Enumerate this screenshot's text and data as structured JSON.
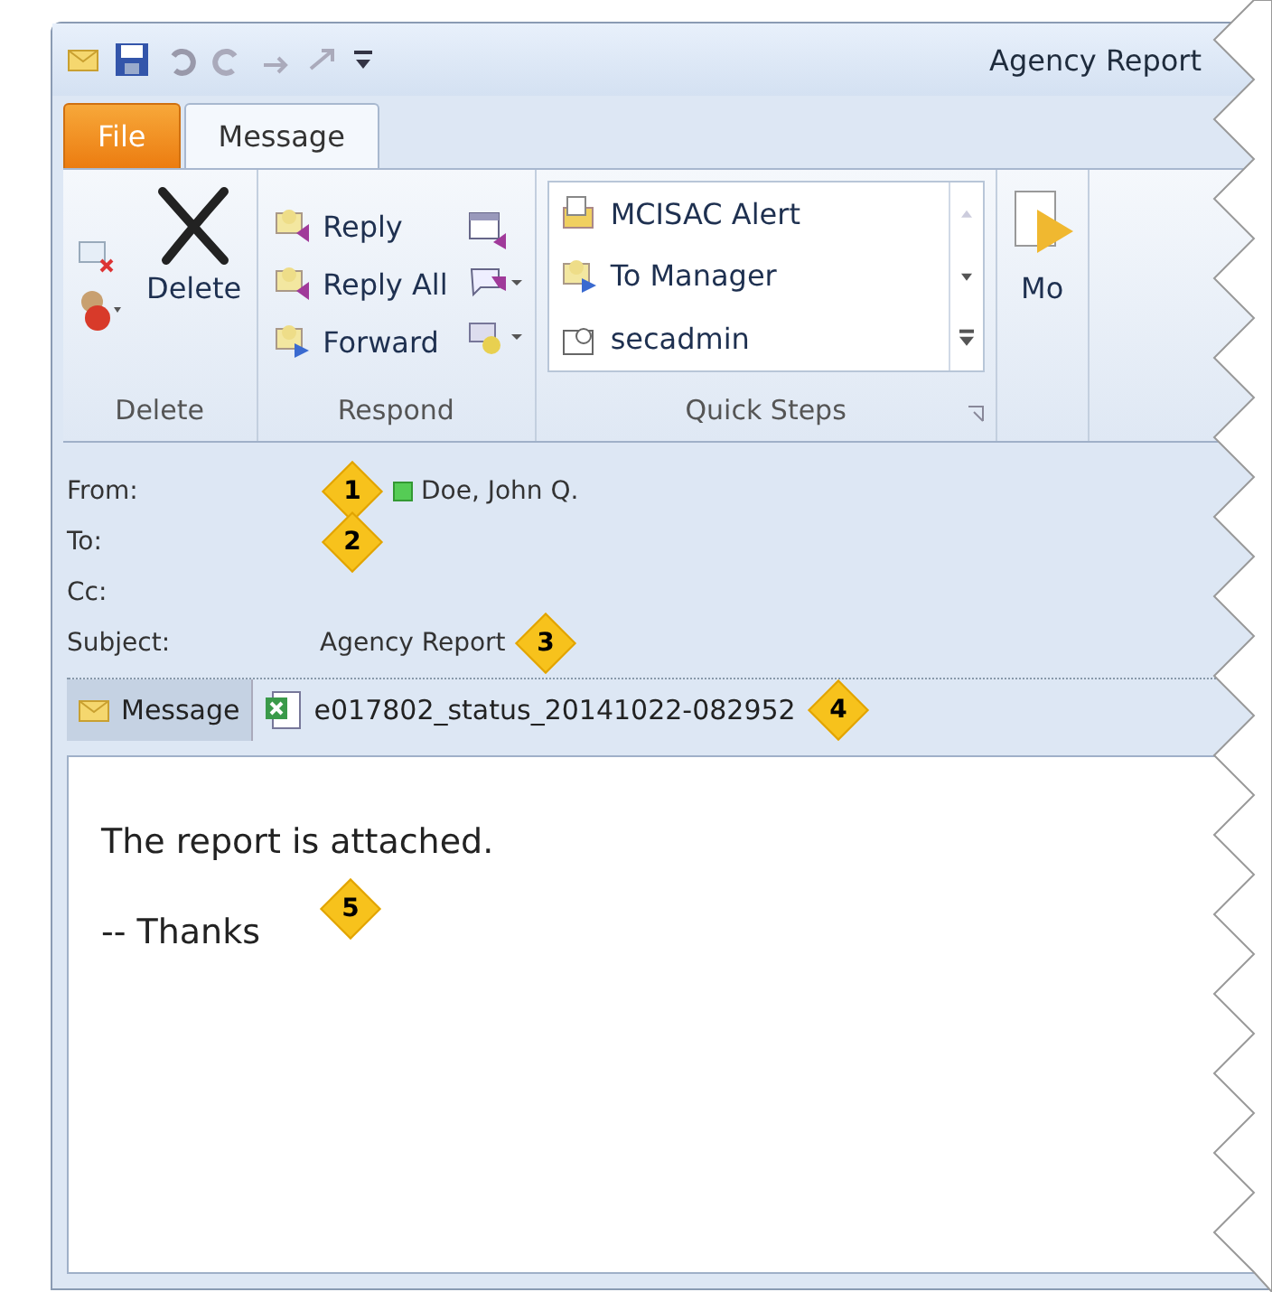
{
  "window": {
    "title": "Agency Report"
  },
  "tabs": [
    {
      "label": "File",
      "kind": "file",
      "selected": false
    },
    {
      "label": "Message",
      "kind": "tab",
      "selected": true
    }
  ],
  "ribbon": {
    "groups": [
      {
        "name": "Delete",
        "kind": "delete",
        "buttons": [
          {
            "label": "Delete"
          }
        ]
      },
      {
        "name": "Respond",
        "kind": "respond",
        "buttons": [
          {
            "label": "Reply"
          },
          {
            "label": "Reply All"
          },
          {
            "label": "Forward"
          }
        ]
      },
      {
        "name": "Quick Steps",
        "kind": "quicksteps",
        "buttons": [
          {
            "label": "MCISAC Alert"
          },
          {
            "label": "To Manager"
          },
          {
            "label": "secadmin"
          }
        ]
      },
      {
        "kind": "move",
        "buttons": [
          {
            "label": "Mo"
          }
        ]
      }
    ]
  },
  "header": {
    "fields": [
      {
        "label": "From:",
        "value": "Doe, John Q.",
        "presence": true,
        "callout": "1"
      },
      {
        "label": "To:",
        "callout": "2"
      },
      {
        "label": "Cc:"
      },
      {
        "label": "Subject:",
        "value": "Agency Report",
        "callout": "3"
      }
    ]
  },
  "attachments": [
    {
      "label": "Message",
      "kind": "message",
      "selected": true
    },
    {
      "label": "e017802_status_20141022-082952",
      "kind": "file",
      "selected": false,
      "callout": "4"
    }
  ],
  "body": {
    "lines": [
      "The report is attached.",
      "-- Thanks"
    ],
    "callout": "5"
  }
}
